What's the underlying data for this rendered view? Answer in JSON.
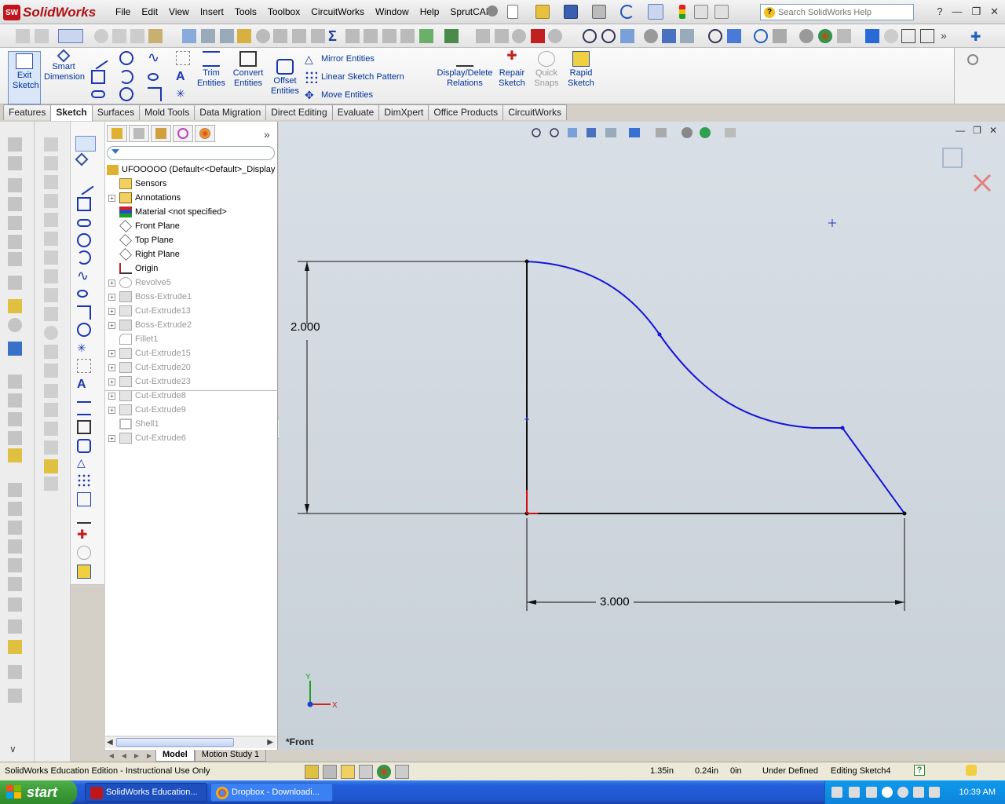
{
  "app": {
    "name": "SolidWorks",
    "badge": "SW"
  },
  "menu": [
    "File",
    "Edit",
    "View",
    "Insert",
    "Tools",
    "Toolbox",
    "CircuitWorks",
    "Window",
    "Help",
    "SprutCAM"
  ],
  "search": {
    "placeholder": "Search SolidWorks Help"
  },
  "commands": {
    "exit_sketch": "Exit Sketch",
    "smart_dimension": "Smart Dimension",
    "trim_entities": "Trim Entities",
    "convert_entities": "Convert Entities",
    "offset_entities": "Offset Entities",
    "mirror_entities": "Mirror Entities",
    "linear_sketch_pattern": "Linear Sketch Pattern",
    "move_entities": "Move Entities",
    "display_delete_relations": "Display/Delete Relations",
    "repair_sketch": "Repair Sketch",
    "quick_snaps": "Quick Snaps",
    "rapid_sketch": "Rapid Sketch"
  },
  "tabs": [
    "Features",
    "Sketch",
    "Surfaces",
    "Mold Tools",
    "Data Migration",
    "Direct Editing",
    "Evaluate",
    "DimXpert",
    "Office Products",
    "CircuitWorks"
  ],
  "active_tab": "Sketch",
  "tree": {
    "root": "UFOOOOO  (Default<<Default>_Display",
    "items": [
      {
        "label": "Sensors",
        "exp": false,
        "suppressed": false,
        "icon": "sensor-icon"
      },
      {
        "label": "Annotations",
        "exp": true,
        "suppressed": false,
        "icon": "annotation-icon"
      },
      {
        "label": "Material <not specified>",
        "exp": false,
        "suppressed": false,
        "icon": "material-icon"
      },
      {
        "label": "Front Plane",
        "exp": false,
        "suppressed": false,
        "icon": "plane-icon"
      },
      {
        "label": "Top Plane",
        "exp": false,
        "suppressed": false,
        "icon": "plane-icon"
      },
      {
        "label": "Right Plane",
        "exp": false,
        "suppressed": false,
        "icon": "plane-icon"
      },
      {
        "label": "Origin",
        "exp": false,
        "suppressed": false,
        "icon": "origin-icon"
      },
      {
        "label": "Revolve5",
        "exp": true,
        "suppressed": true,
        "icon": "revolve-icon"
      },
      {
        "label": "Boss-Extrude1",
        "exp": true,
        "suppressed": true,
        "icon": "extrude-icon"
      },
      {
        "label": "Cut-Extrude13",
        "exp": true,
        "suppressed": true,
        "icon": "cut-extrude-icon"
      },
      {
        "label": "Boss-Extrude2",
        "exp": true,
        "suppressed": true,
        "icon": "extrude-icon"
      },
      {
        "label": "Fillet1",
        "exp": false,
        "suppressed": true,
        "icon": "fillet-icon"
      },
      {
        "label": "Cut-Extrude15",
        "exp": true,
        "suppressed": true,
        "icon": "cut-extrude-icon"
      },
      {
        "label": "Cut-Extrude20",
        "exp": true,
        "suppressed": true,
        "icon": "cut-extrude-icon"
      },
      {
        "label": "Cut-Extrude23",
        "exp": true,
        "suppressed": true,
        "icon": "cut-extrude-icon"
      },
      {
        "label": "Cut-Extrude8",
        "exp": true,
        "suppressed": true,
        "icon": "cut-extrude-icon"
      },
      {
        "label": "Cut-Extrude9",
        "exp": true,
        "suppressed": true,
        "icon": "cut-extrude-icon"
      },
      {
        "label": "Shell1",
        "exp": false,
        "suppressed": true,
        "icon": "shell-icon"
      },
      {
        "label": "Cut-Extrude6",
        "exp": true,
        "suppressed": true,
        "icon": "cut-extrude-icon"
      }
    ]
  },
  "sketch": {
    "height_dimension": "2.000",
    "width_dimension": "3.000",
    "view_name": "*Front",
    "axis_x": "X",
    "axis_y": "Y"
  },
  "bottom_tabs": [
    "Model",
    "Motion Study 1"
  ],
  "status": {
    "edition": "SolidWorks Education Edition - Instructional Use Only",
    "x": "1.35in",
    "y": "0.24in",
    "z": "0in",
    "state": "Under Defined",
    "editing": "Editing Sketch4",
    "help": "?"
  },
  "taskbar": {
    "start": "start",
    "tasks": [
      "SolidWorks Education...",
      "Dropbox - Downloadi..."
    ],
    "clock": "10:39 AM"
  },
  "colors": {
    "sketch_curve": "#1515d8",
    "sketch_line": "#111111",
    "accent_blue": "#003399"
  }
}
